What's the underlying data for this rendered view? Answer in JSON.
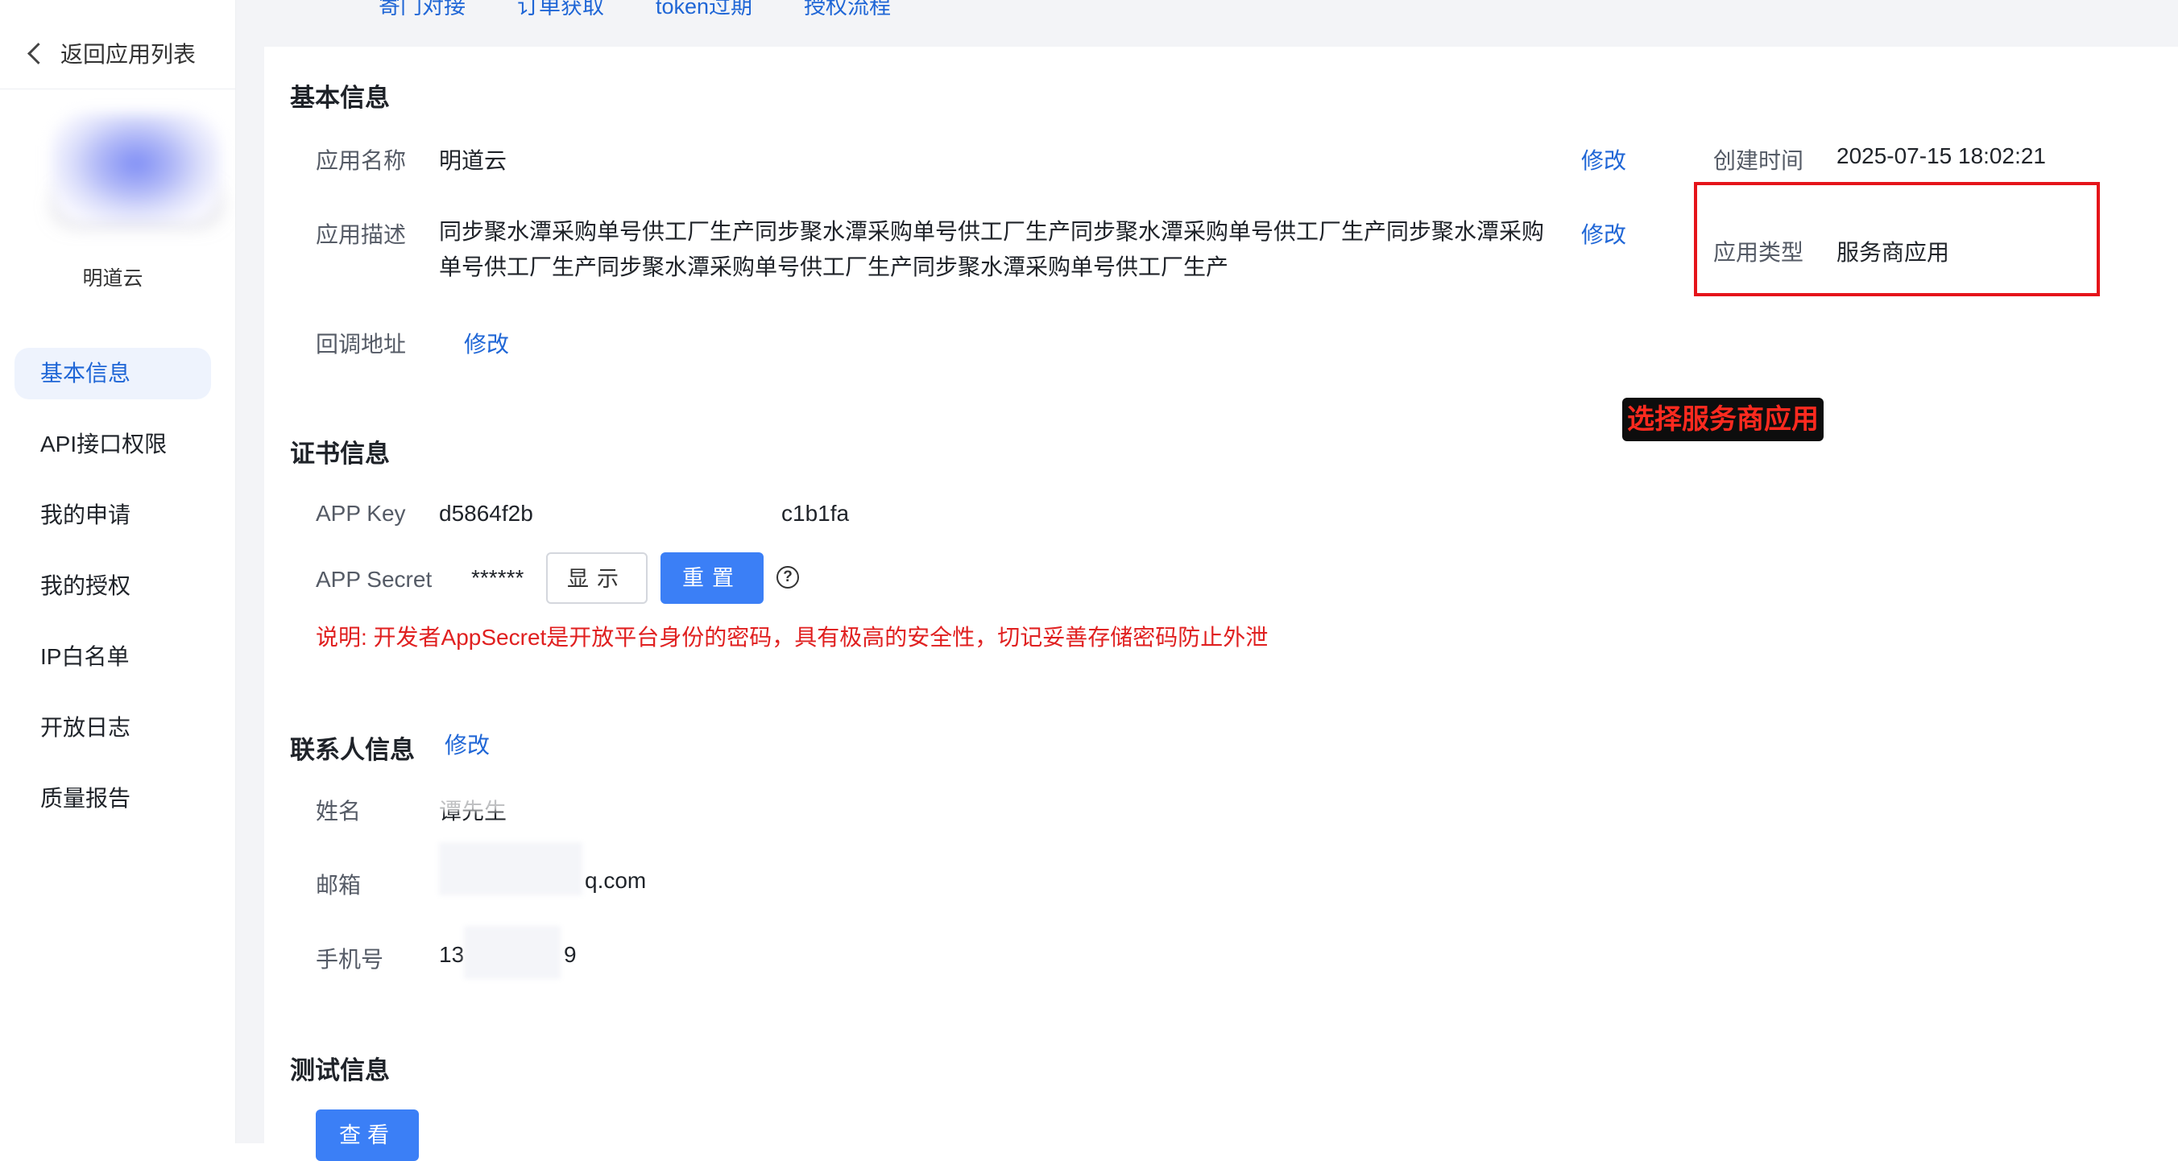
{
  "top_links": [
    "寄门对接",
    "订单获取",
    "token过期",
    "授权流程"
  ],
  "sidebar": {
    "back_label": "返回应用列表",
    "app_name": "明道云",
    "items": [
      {
        "label": "基本信息",
        "active": true
      },
      {
        "label": "API接口权限"
      },
      {
        "label": "我的申请"
      },
      {
        "label": "我的授权"
      },
      {
        "label": "IP白名单"
      },
      {
        "label": "开放日志"
      },
      {
        "label": "质量报告"
      }
    ]
  },
  "basic": {
    "title": "基本信息",
    "name_label": "应用名称",
    "name_value": "明道云",
    "desc_label": "应用描述",
    "desc_value": "同步聚水潭采购单号供工厂生产同步聚水潭采购单号供工厂生产同步聚水潭采购单号供工厂生产同步聚水潭采购单号供工厂生产同步聚水潭采购单号供工厂生产同步聚水潭采购单号供工厂生产",
    "callback_label": "回调地址",
    "edit_label": "修改",
    "created_label": "创建时间",
    "created_value": "2025-07-15 18:02:21",
    "type_label": "应用类型",
    "type_value": "服务商应用"
  },
  "annotation": {
    "text": "选择服务商应用",
    "highlight_color": "#e5141a"
  },
  "cert": {
    "title": "证书信息",
    "key_label": "APP Key",
    "key_prefix": "d5864f2b",
    "key_suffix": "c1b1fa",
    "secret_label": "APP Secret",
    "secret_value": "******",
    "show_button": "显示",
    "reset_button": "重置",
    "help_glyph": "?",
    "note": "说明: 开发者AppSecret是开放平台身份的密码，具有极高的安全性，切记妥善存储密码防止外泄"
  },
  "contact": {
    "title": "联系人信息",
    "edit_label": "修改",
    "name_label": "姓名",
    "name_value": "谭先生",
    "email_label": "邮箱",
    "email_suffix": "q.com",
    "phone_label": "手机号",
    "phone_prefix": "13",
    "phone_suffix": "9"
  },
  "test": {
    "title": "测试信息",
    "view_button": "查看"
  },
  "colors": {
    "primary": "#3b7ff6",
    "link": "#1f66d6",
    "warning": "#e02020",
    "sidebar_active_bg": "#eef3fd"
  }
}
